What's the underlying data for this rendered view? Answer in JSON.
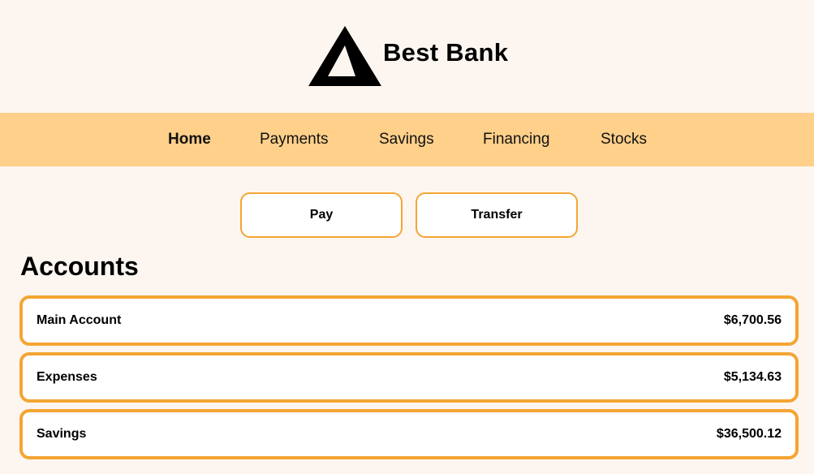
{
  "brand": {
    "name": "Best Bank",
    "logo_icon": "triangle-logo-icon"
  },
  "nav": {
    "items": [
      {
        "label": "Home",
        "active": true
      },
      {
        "label": "Payments",
        "active": false
      },
      {
        "label": "Savings",
        "active": false
      },
      {
        "label": "Financing",
        "active": false
      },
      {
        "label": "Stocks",
        "active": false
      }
    ]
  },
  "actions": {
    "pay_label": "Pay",
    "transfer_label": "Transfer"
  },
  "accounts": {
    "title": "Accounts",
    "items": [
      {
        "name": "Main Account",
        "balance": "$6,700.56"
      },
      {
        "name": "Expenses",
        "balance": "$5,134.63"
      },
      {
        "name": "Savings",
        "balance": "$36,500.12"
      }
    ]
  },
  "colors": {
    "background": "#fdf6f0",
    "nav_background": "#ffd08a",
    "accent_border": "#f4a534",
    "card_background": "#ffffff"
  }
}
